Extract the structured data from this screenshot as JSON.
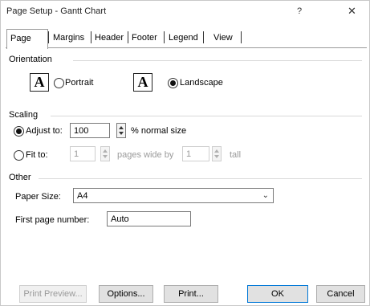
{
  "window": {
    "title": "Page Setup - Gantt Chart",
    "help": "?",
    "close": "✕"
  },
  "tabs": [
    "Page",
    "Margins",
    "Header",
    "Footer",
    "Legend",
    "View"
  ],
  "orientation": {
    "label": "Orientation",
    "glyph": "A",
    "portrait": "Portrait",
    "landscape": "Landscape",
    "selected": "landscape"
  },
  "scaling": {
    "label": "Scaling",
    "adjust_to_label": "Adjust to:",
    "adjust_value": "100",
    "normal_size": "% normal size",
    "fit_to_label": "Fit to:",
    "fit_wide": "1",
    "pages_wide_by": "pages wide by",
    "fit_tall": "1",
    "tall": "tall"
  },
  "other": {
    "label": "Other",
    "paper_size_label": "Paper Size:",
    "paper_size": "A4",
    "first_page_label": "First page number:",
    "first_page": "Auto"
  },
  "buttons": {
    "print_preview": "Print Preview...",
    "options": "Options...",
    "print": "Print...",
    "ok": "OK",
    "cancel": "Cancel"
  }
}
